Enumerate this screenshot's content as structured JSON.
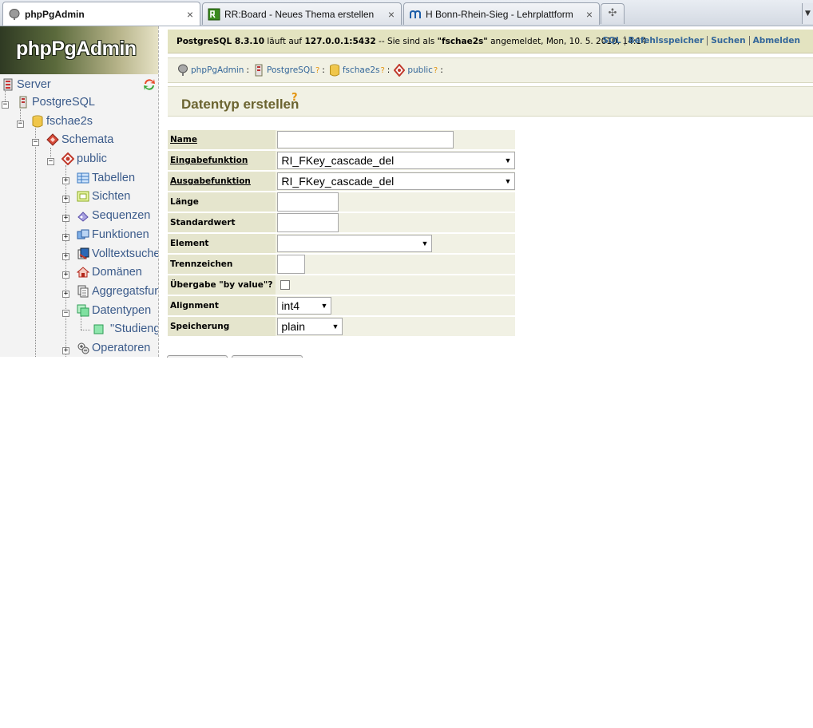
{
  "browser": {
    "tabs": [
      {
        "label": "phpPgAdmin",
        "close": "×",
        "active": true
      },
      {
        "label": "RR:Board - Neues Thema erstellen",
        "close": "×",
        "active": false
      },
      {
        "label": "H Bonn-Rhein-Sieg - Lehrplattform",
        "close": "×",
        "active": false
      }
    ],
    "new_tab": "✣",
    "tab_menu": "▼"
  },
  "sidebar": {
    "logo": "phpPgAdmin",
    "tree": {
      "server": "Server",
      "postgresql": "PostgreSQL",
      "database": "fschae2s",
      "schemata": "Schemata",
      "schema": "public",
      "tabellen": "Tabellen",
      "sichten": "Sichten",
      "sequenzen": "Sequenzen",
      "funktionen": "Funktionen",
      "volltextsuche": "Volltextsuche",
      "domaenen": "Domänen",
      "aggregatsfunk": "Aggregatsfunk",
      "datentypen": "Datentypen",
      "studienga": "\"Studienga",
      "operatoren": "Operatoren"
    },
    "toggles": {
      "expand": "+",
      "collapse": "−"
    }
  },
  "infobar": {
    "server_version": "PostgreSQL 8.3.10",
    "runs_on": " läuft auf ",
    "host": "127.0.0.1:5432",
    "logged_in_as": " -- Sie sind als ",
    "user": "\"fschae2s\"",
    "rest": " angemeldet, Mon, 10. 5. 2010, 14:14"
  },
  "toplinks": {
    "sql": "SQL",
    "history": "Befehlsspeicher",
    "find": "Suchen",
    "logout": "Abmelden"
  },
  "trail": {
    "app": "phpPgAdmin",
    "server": "PostgreSQL",
    "database": "fschae2s",
    "schema": "public",
    "help": "?",
    "colon": ":"
  },
  "page": {
    "title": "Datentyp erstellen",
    "title_help": "?"
  },
  "form": {
    "name_label": "Name",
    "name_value": "",
    "input_label": "Eingabefunktion",
    "input_value": "RI_FKey_cascade_del",
    "output_label": "Ausgabefunktion",
    "output_value": "RI_FKey_cascade_del",
    "length_label": "Länge",
    "length_value": "",
    "default_label": "Standardwert",
    "default_value": "",
    "element_label": "Element",
    "element_value": "",
    "delimiter_label": "Trennzeichen",
    "delimiter_value": "",
    "byvalue_label": "Übergabe \"by value\"?",
    "byvalue_checked": false,
    "alignment_label": "Alignment",
    "alignment_value": "int4",
    "storage_label": "Speicherung",
    "storage_value": "plain",
    "dropdown_arrow": "▼"
  },
  "colors": {
    "infobar_bg": "#e3e3c0",
    "label_bg": "#e5e5cd",
    "cell_bg": "#f1f1e4",
    "link": "#336699",
    "title": "#6b6430",
    "help": "#e3930d"
  }
}
